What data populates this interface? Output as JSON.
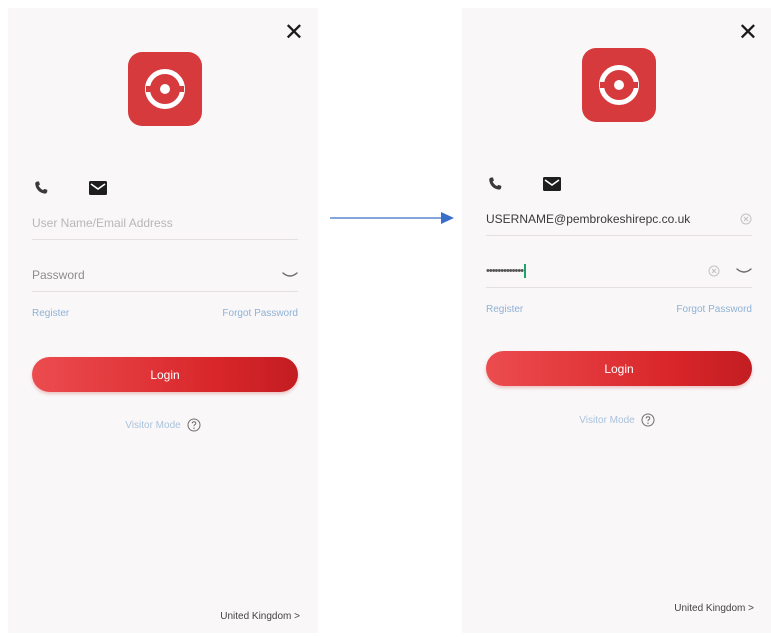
{
  "left_screen": {
    "close_label": "✕",
    "username_placeholder": "User Name/Email Address",
    "password_placeholder": "Password",
    "register_label": "Register",
    "forgot_label": "Forgot Password",
    "login_label": "Login",
    "mode_label": "Visitor Mode",
    "region_label": "United Kingdom",
    "region_chevron": ">"
  },
  "right_screen": {
    "close_label": "✕",
    "username_value": "USERNAME@pembrokeshirepc.co.uk",
    "password_masked": "•••••••••••••",
    "register_label": "Register",
    "forgot_label": "Forgot Password",
    "login_label": "Login",
    "mode_label": "Visitor Mode",
    "region_label": "United Kingdom",
    "region_chevron": ">"
  },
  "icons": {
    "close": "close-icon",
    "logo": "app-logo",
    "phone": "phone-icon",
    "mail": "mail-icon",
    "eye": "eye-closed-icon",
    "clear": "clear-icon",
    "help": "help-icon",
    "arrow": "arrow-right-icon"
  },
  "colors": {
    "accent": "#d63a3d",
    "link": "#8fb2d6",
    "background": "#f9f7f8",
    "arrow": "#3a6fc9"
  }
}
